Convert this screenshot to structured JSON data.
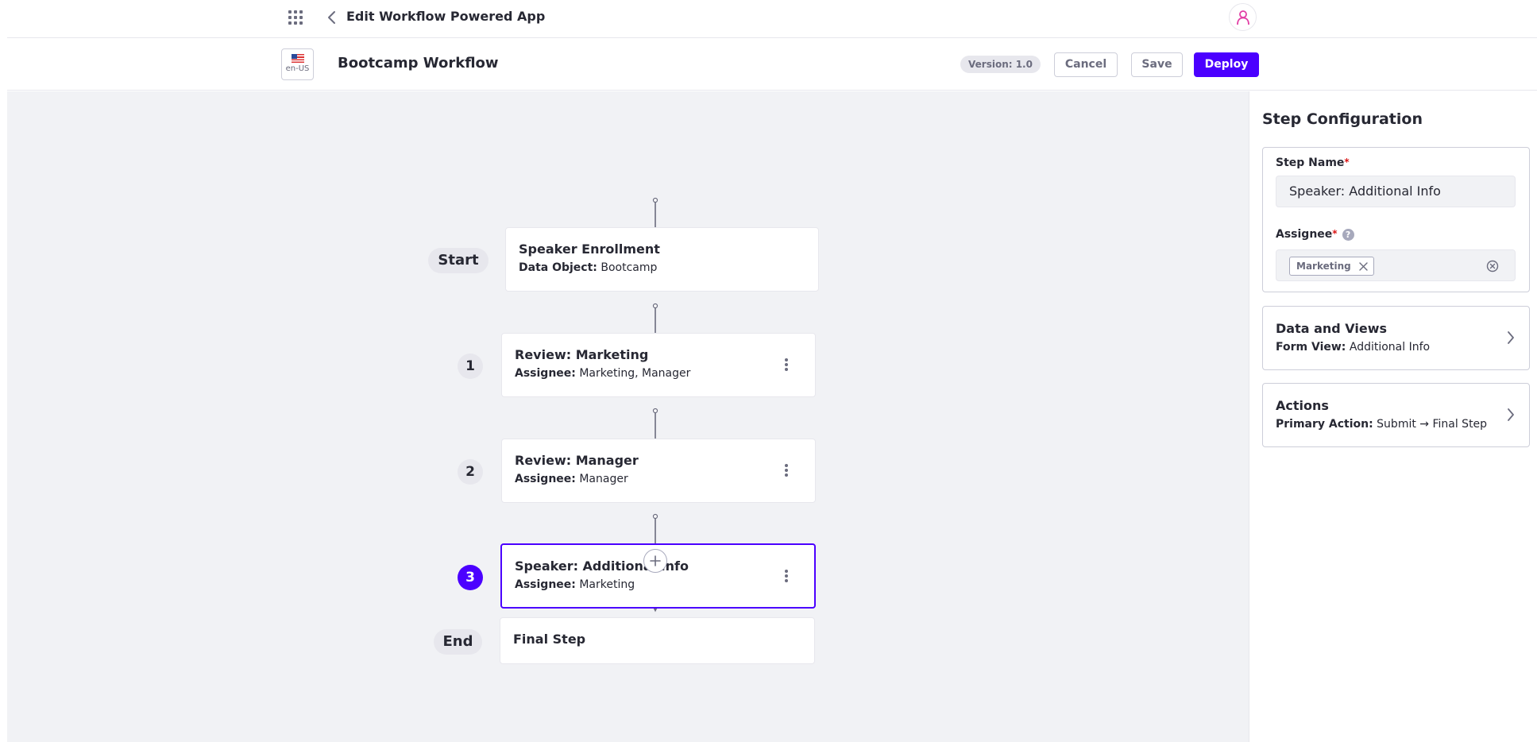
{
  "header": {
    "title": "Edit Workflow Powered App"
  },
  "toolbar": {
    "locale": "en-US",
    "workflow_name": "Bootcamp Workflow",
    "version": "Version: 1.0",
    "cancel_label": "Cancel",
    "save_label": "Save",
    "deploy_label": "Deploy"
  },
  "colors": {
    "primary": "#4b00ff",
    "canvas_bg": "#f1f2f5",
    "avatar_accent": "#e23ea5"
  },
  "flow": {
    "start": {
      "badge": "Start",
      "title": "Speaker Enrollment",
      "sub_key": "Data Object:",
      "sub_value": "Bootcamp"
    },
    "steps": [
      {
        "number": "1",
        "title": "Review: Marketing",
        "sub_key": "Assignee:",
        "sub_value": "Marketing, Manager",
        "selected": false
      },
      {
        "number": "2",
        "title": "Review: Manager",
        "sub_key": "Assignee:",
        "sub_value": "Manager",
        "selected": false
      },
      {
        "number": "3",
        "title": "Speaker: Additional Info",
        "sub_key": "Assignee:",
        "sub_value": "Marketing",
        "selected": true
      }
    ],
    "end": {
      "badge": "End",
      "title": "Final Step"
    }
  },
  "sidebar": {
    "title": "Step Configuration",
    "step_name_label": "Step Name",
    "step_name_value": "Speaker: Additional Info",
    "assignee_label": "Assignee",
    "help": "?",
    "required_mark": "*",
    "assignee_tags": [
      "Marketing"
    ],
    "data_views": {
      "title": "Data and Views",
      "sub_key": "Form View:",
      "sub_value": "Additional Info"
    },
    "actions": {
      "title": "Actions",
      "sub_key": "Primary Action:",
      "sub_value": "Submit → Final Step"
    }
  }
}
